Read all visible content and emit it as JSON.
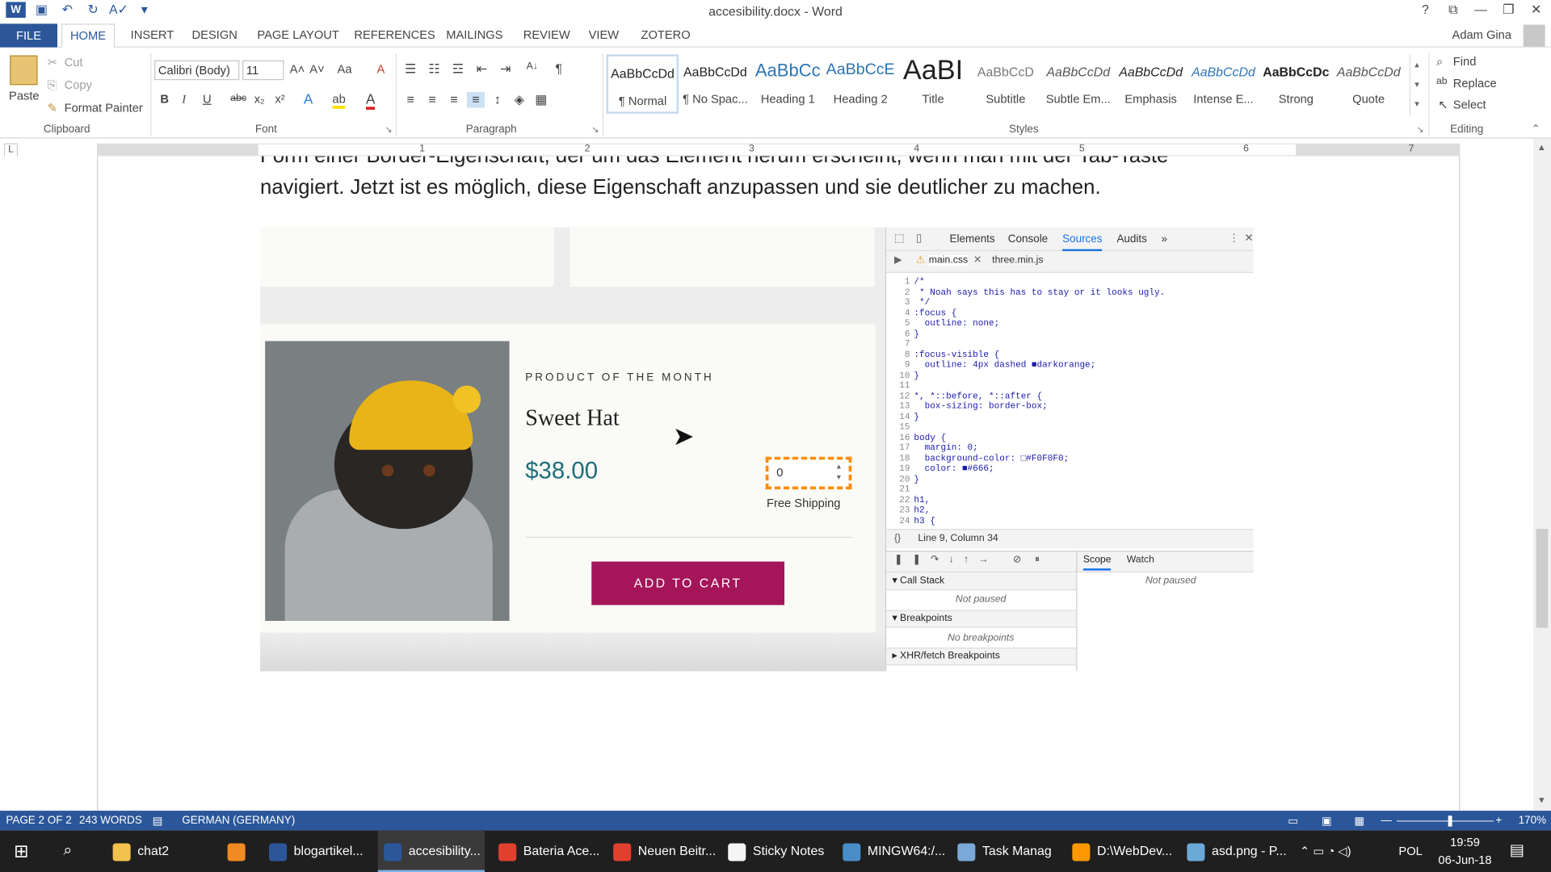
{
  "window": {
    "title": "accesibility.docx - Word",
    "help": "?",
    "ctrl_restore_ribbon": "⧉",
    "ctrl_min": "—",
    "ctrl_max": "❐",
    "ctrl_close": "✕"
  },
  "qat": {
    "word_icon": "word-icon",
    "save_icon": "save-icon",
    "undo_icon": "undo-icon",
    "redo_icon": "redo-icon",
    "spell_icon": "spelling-icon",
    "customize_icon": "customize-qat-icon"
  },
  "tabs": {
    "file": "FILE",
    "items": [
      "HOME",
      "INSERT",
      "DESIGN",
      "PAGE LAYOUT",
      "REFERENCES",
      "MAILINGS",
      "REVIEW",
      "VIEW",
      "ZOTERO"
    ]
  },
  "user": {
    "name": "Adam Gina"
  },
  "clipboard": {
    "paste": "Paste",
    "cut": "Cut",
    "copy": "Copy",
    "format_painter": "Format Painter",
    "label": "Clipboard"
  },
  "font": {
    "name": "Calibri (Body)",
    "size": "11",
    "grow": "A˄",
    "shrink": "A˅",
    "case": "Aa",
    "clear": "A",
    "bold": "B",
    "italic": "I",
    "underline": "U",
    "strike": "abc",
    "sub": "x₂",
    "sup": "x²",
    "effects": "A",
    "highlight": "ab",
    "color": "A",
    "label": "Font"
  },
  "paragraph": {
    "label": "Paragraph",
    "pilcrow": "¶",
    "sort": "A↓"
  },
  "styles": {
    "label": "Styles",
    "items": [
      {
        "preview": "AaBbCcDd",
        "name": "¶ Normal"
      },
      {
        "preview": "AaBbCcDd",
        "name": "¶ No Spac..."
      },
      {
        "preview": "AaBbCc",
        "name": "Heading 1"
      },
      {
        "preview": "AaBbCcE",
        "name": "Heading 2"
      },
      {
        "preview": "AaBI",
        "name": "Title"
      },
      {
        "preview": "AaBbCcD",
        "name": "Subtitle"
      },
      {
        "preview": "AaBbCcDd",
        "name": "Subtle Em..."
      },
      {
        "preview": "AaBbCcDd",
        "name": "Emphasis"
      },
      {
        "preview": "AaBbCcDd",
        "name": "Intense E..."
      },
      {
        "preview": "AaBbCcDc",
        "name": "Strong"
      },
      {
        "preview": "AaBbCcDd",
        "name": "Quote"
      }
    ]
  },
  "editing": {
    "label": "Editing",
    "find": "Find",
    "replace": "Replace",
    "select": "Select"
  },
  "ruler": {
    "numbers": [
      "1",
      "2",
      "3",
      "4",
      "5",
      "6",
      "7"
    ],
    "tab_selector": "L"
  },
  "document": {
    "line1": "Form einer Border-Eigenschaft, der um das Element herum erscheint, wenn man mit der Tab-Taste",
    "line2": "navigiert. Jetzt ist es möglich, diese Eigenschaft anzupassen und sie deutlicher zu machen."
  },
  "product": {
    "kicker": "PRODUCT OF THE MONTH",
    "name": "Sweet Hat",
    "price": "$38.00",
    "qty": "0",
    "shipping": "Free Shipping",
    "cta": "ADD TO CART"
  },
  "devtools": {
    "tabs": [
      "Elements",
      "Console",
      "Sources",
      "Audits",
      "»"
    ],
    "files": [
      "main.css",
      "three.min.js"
    ],
    "line_numbers": "1\n2\n3\n4\n5\n6\n7\n8\n9\n10\n11\n12\n13\n14\n15\n16\n17\n18\n19\n20\n21\n22\n23\n24",
    "code": "/*\n * Noah says this has to stay or it looks ugly.\n */\n:focus {\n  outline: none;\n}\n\n:focus-visible {\n  outline: 4px dashed ■darkorange;\n}\n\n*, *::before, *::after {\n  box-sizing: border-box;\n}\n\nbody {\n  margin: 0;\n  background-color: □#F0F0F0;\n  color: ■#666;\n}\n\nh1,\nh2,\nh3 {",
    "position": "Line 9, Column 34",
    "braces": "{}",
    "call_stack": "Call Stack",
    "not_paused": "Not paused",
    "breakpoints": "Breakpoints",
    "no_breakpoints": "No breakpoints",
    "xhr": "XHR/fetch Breakpoints",
    "scope": "Scope",
    "watch": "Watch",
    "scope_not_paused": "Not paused"
  },
  "status": {
    "page": "PAGE 2 OF 2",
    "words": "243 WORDS",
    "language": "GERMAN (GERMANY)",
    "zoom": "170%"
  },
  "taskbar": {
    "items": [
      {
        "label": "chat2",
        "color": "#f2c14e"
      },
      {
        "label": "",
        "color": "#f08a24"
      },
      {
        "label": "blogartikel...",
        "color": "#2b579a"
      },
      {
        "label": "accesibility...",
        "color": "#2b579a"
      },
      {
        "label": "Bateria Ace...",
        "color": "#e0412f"
      },
      {
        "label": "Neuen Beitr...",
        "color": "#e0412f"
      },
      {
        "label": "Sticky Notes",
        "color": "#f5f5f5"
      },
      {
        "label": "MINGW64:/...",
        "color": "#4a8ec9"
      },
      {
        "label": "Task Manag",
        "color": "#7aa8d8"
      },
      {
        "label": "D:\\WebDev...",
        "color": "#ff9800"
      },
      {
        "label": "asd.png - P...",
        "color": "#6aa9d8"
      }
    ],
    "language": "POL",
    "time": "19:59",
    "date": "06-Jun-18"
  },
  "colors": {
    "accent": "#2b579a",
    "cta": "#a4155a",
    "price": "#1f6e79",
    "focus_outline": "#ff8c00"
  }
}
